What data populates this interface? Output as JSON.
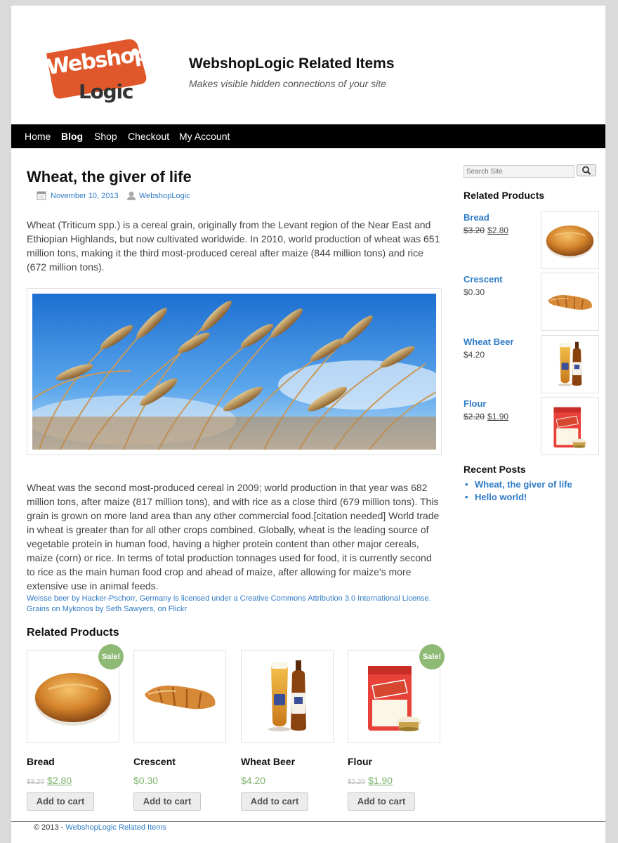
{
  "site": {
    "title": "WebshopLogic Related Items",
    "tagline": "Makes visible hidden connections of your site",
    "logo_text_1": "Webshop",
    "logo_text_2": "Logic"
  },
  "nav": {
    "items": [
      {
        "label": "Home",
        "active": false
      },
      {
        "label": "Blog",
        "active": true
      },
      {
        "label": "Shop",
        "active": false
      },
      {
        "label": "Checkout",
        "active": false
      },
      {
        "label": "My Account",
        "active": false
      }
    ]
  },
  "post": {
    "title": "Wheat, the giver of life",
    "date": "November 10, 2013",
    "author": "WebshopLogic",
    "para1": "Wheat (Triticum spp.) is a cereal grain, originally from the Levant region of the Near East and Ethiopian Highlands, but now cultivated worldwide. In 2010, world production of wheat was 651 million tons, making it the third most-produced cereal after maize (844 million tons) and rice (672 million tons).",
    "para2": "Wheat was the second most-produced cereal in 2009; world production in that year was 682 million tons, after maize (817 million tons), and with rice as a close third (679 million tons). This grain is grown on more land area than any other commercial food.[citation needed] World trade in wheat is greater than for all other crops combined. Globally, wheat is the leading source of vegetable protein in human food, having a higher protein content than other major cereals, maize (corn) or rice. In terms of total production tonnages used for food, it is currently second to rice as the main human food crop and ahead of maize, after allowing for maize's more extensive use in animal feeds.",
    "credit1": "Weisse beer by Hacker-Pschorr, Germany is licensed under a Creative Commons Attribution 3.0 International License.",
    "credit2": "Grains on Mykonos by Seth Sawyers, on Flickr"
  },
  "related": {
    "heading": "Related Products",
    "products": [
      {
        "name": "Bread",
        "old_price": "$3.20",
        "price": "$2.80",
        "sale": "Sale!",
        "button": "Add to cart"
      },
      {
        "name": "Crescent",
        "old_price": "",
        "price": "$0.30",
        "sale": "",
        "button": "Add to cart"
      },
      {
        "name": "Wheat Beer",
        "old_price": "",
        "price": "$4.20",
        "sale": "",
        "button": "Add to cart"
      },
      {
        "name": "Flour",
        "old_price": "$2.20",
        "price": "$1.90",
        "sale": "Sale!",
        "button": "Add to cart"
      }
    ]
  },
  "sidebar": {
    "search_placeholder": "Search Site",
    "related_heading": "Related Products",
    "products": [
      {
        "name": "Bread",
        "old_price": "$3.20",
        "price": "$2.80"
      },
      {
        "name": "Crescent",
        "old_price": "",
        "price": "$0.30"
      },
      {
        "name": "Wheat Beer",
        "old_price": "",
        "price": "$4.20"
      },
      {
        "name": "Flour",
        "old_price": "$2.20",
        "price": "$1.90"
      }
    ],
    "recent_heading": "Recent Posts",
    "recent_posts": [
      "Wheat, the giver of life",
      "Hello world!"
    ]
  },
  "footer": {
    "copyright": "© 2013 - ",
    "link": "WebshopLogic Related Items"
  },
  "colors": {
    "accent": "#2f7bc6",
    "nav_bg": "#000000",
    "sale_badge": "#8fba75",
    "price_green": "#7bb36c",
    "logo_orange": "#e0572b"
  }
}
